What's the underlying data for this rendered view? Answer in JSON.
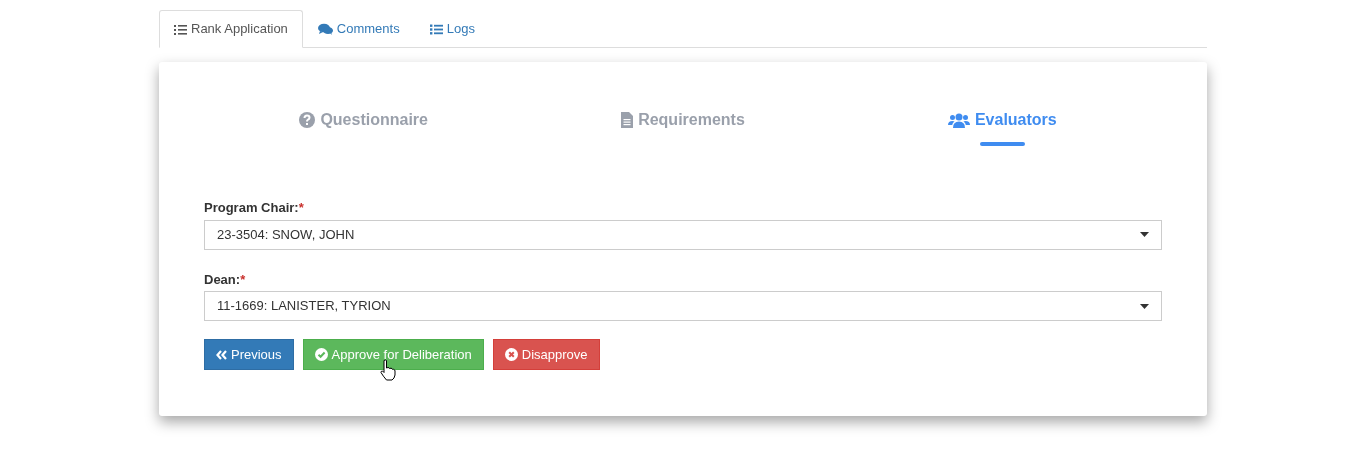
{
  "tabs": [
    {
      "label": "Rank Application",
      "kind": "checklist",
      "selected": true
    },
    {
      "label": "Comments",
      "kind": "comments",
      "selected": false
    },
    {
      "label": "Logs",
      "kind": "list",
      "selected": false
    }
  ],
  "steps": [
    {
      "label": "Questionnaire",
      "kind": "question",
      "selected": false
    },
    {
      "label": "Requirements",
      "kind": "file",
      "selected": false
    },
    {
      "label": "Evaluators",
      "kind": "users",
      "selected": true
    }
  ],
  "fields": [
    {
      "label": "Program Chair:",
      "required": true,
      "required_mark": "*",
      "value": "23-3504: SNOW, JOHN"
    },
    {
      "label": "Dean:",
      "required": true,
      "required_mark": "*",
      "value": "11-1669: LANISTER, TYRION"
    }
  ],
  "buttons": [
    {
      "label": "Previous",
      "kind": "previous"
    },
    {
      "label": "Approve for Deliberation",
      "kind": "approve"
    },
    {
      "label": "Disapprove",
      "kind": "disapprove"
    }
  ]
}
